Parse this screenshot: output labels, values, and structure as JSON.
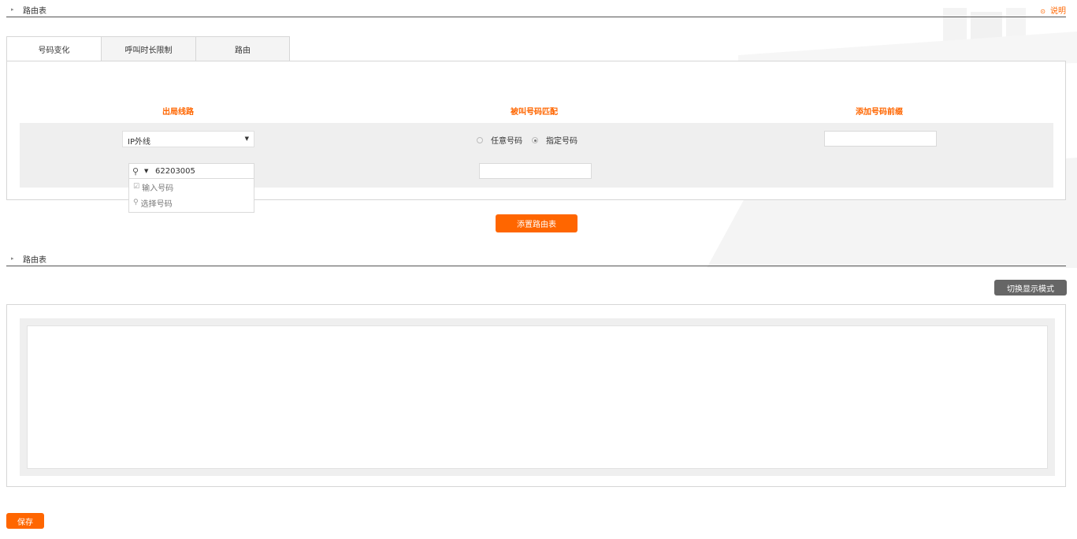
{
  "header": {
    "title": "路由表",
    "help_label": "说明"
  },
  "tabs": [
    {
      "label": "号码变化",
      "active": true
    },
    {
      "label": "呼叫时长限制",
      "active": false
    },
    {
      "label": "路由",
      "active": false
    }
  ],
  "form": {
    "col_outbound": "出局线路",
    "col_called_match": "被叫号码匹配",
    "col_add_prefix": "添加号码前缀",
    "trunk_select_value": "IP外线",
    "radio_any": "任意号码",
    "radio_specified": "指定号码",
    "radio_selected": "specified",
    "number_value": "62203005",
    "menu_input_number": "输入号码",
    "menu_select_number": "选择号码"
  },
  "add_route_button": "添置路由表",
  "route_table": {
    "title": "路由表",
    "switch_mode_button": "切换显示模式"
  },
  "save_button": "保存",
  "colors": {
    "accent": "#ff6600",
    "dark_button": "#666666"
  }
}
